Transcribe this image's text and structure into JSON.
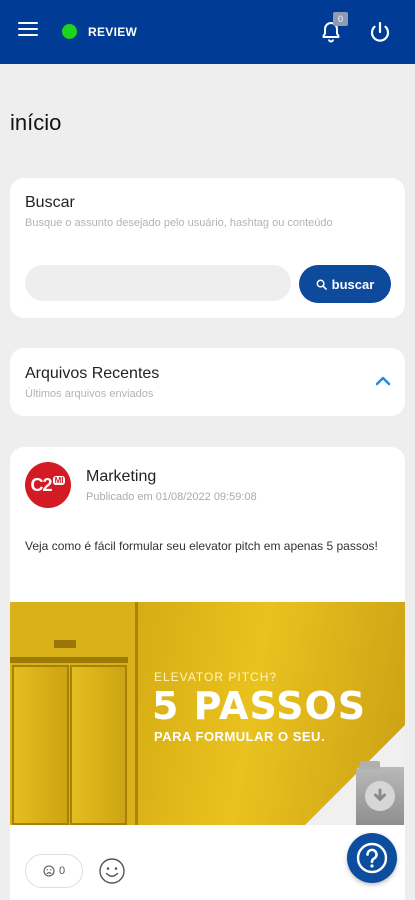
{
  "header": {
    "status_label": "REVIEW",
    "notification_count": "0",
    "colors": {
      "bar": "#003b95",
      "status": "#21d321"
    }
  },
  "page": {
    "title": "início"
  },
  "search": {
    "title": "Buscar",
    "subtitle": "Busque o assunto desejado pelo usuário, hashtag ou conteúdo",
    "placeholder": "",
    "button_label": "buscar"
  },
  "recent": {
    "title": "Arquivos Recentes",
    "subtitle": "Últimos arquivos enviados"
  },
  "post": {
    "avatar_text": "C2",
    "avatar_sup": "MI",
    "author": "Marketing",
    "published": "Publicado em 01/08/2022 09:59:08",
    "text": "Veja como é fácil formular seu elevator pitch em apenas 5 passos!",
    "image": {
      "question": "ELEVATOR PITCH?",
      "headline": "5 PASSOS",
      "tagline": "PARA FORMULAR O SEU."
    },
    "reaction_count": "0"
  }
}
